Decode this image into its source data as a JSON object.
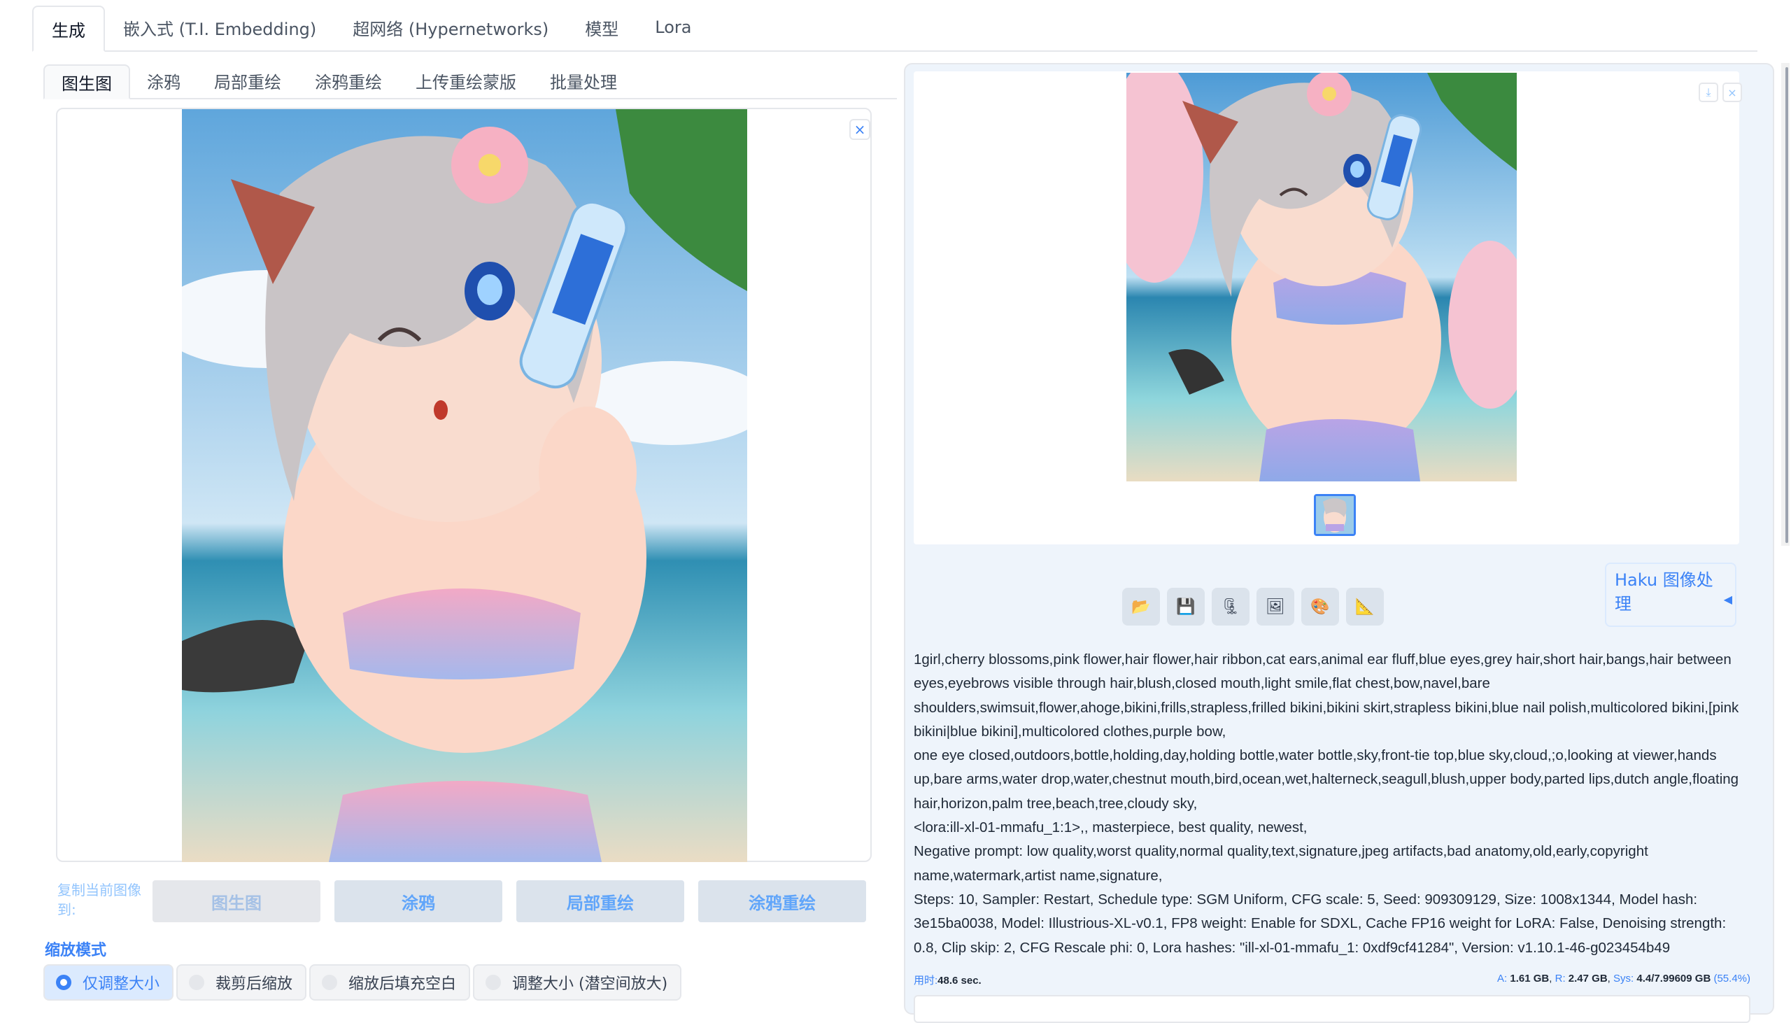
{
  "top_tabs": [
    "生成",
    "嵌入式 (T.I. Embedding)",
    "超网络 (Hypernetworks)",
    "模型",
    "Lora"
  ],
  "sub_tabs": [
    "图生图",
    "涂鸦",
    "局部重绘",
    "涂鸦重绘",
    "上传重绘蒙版",
    "批量处理"
  ],
  "copy": {
    "label": "复制当前图像到:",
    "buttons": [
      "图生图",
      "涂鸦",
      "局部重绘",
      "涂鸦重绘"
    ]
  },
  "scale": {
    "label": "缩放模式",
    "options": [
      "仅调整大小",
      "裁剪后缩放",
      "缩放后填充空白",
      "调整大小 (潜空间放大)"
    ],
    "selected": "仅调整大小"
  },
  "icons": {
    "close": "×",
    "download": "⤓",
    "folder": "📂",
    "save": "💾",
    "zip": "🗜",
    "image": "🖼",
    "palette": "🎨",
    "ruler": "📐"
  },
  "haku": {
    "label": "Haku 图像处理",
    "arrow": "◀"
  },
  "gen_info": [
    "1girl,cherry blossoms,pink flower,hair flower,hair ribbon,cat ears,animal ear fluff,blue eyes,grey hair,short hair,bangs,hair between eyes,eyebrows visible through hair,blush,closed mouth,light smile,flat chest,bow,navel,bare shoulders,swimsuit,flower,ahoge,bikini,frills,strapless,frilled bikini,bikini skirt,strapless bikini,blue nail polish,multicolored bikini,[pink bikini|blue bikini],multicolored clothes,purple bow,",
    "one eye closed,outdoors,bottle,holding,day,holding bottle,water bottle,sky,front-tie top,blue sky,cloud,;o,looking at viewer,hands up,bare arms,water drop,water,chestnut mouth,bird,ocean,wet,halterneck,seagull,blush,upper body,parted lips,dutch angle,floating hair,horizon,palm tree,beach,tree,cloudy sky,",
    "<lora:ill-xl-01-mmafu_1:1>,, masterpiece, best quality, newest,",
    "Negative prompt: low quality,worst quality,normal quality,text,signature,jpeg artifacts,bad anatomy,old,early,copyright name,watermark,artist name,signature,",
    "Steps: 10, Sampler: Restart, Schedule type: SGM Uniform, CFG scale: 5, Seed: 909309129, Size: 1008x1344, Model hash: 3e15ba0038, Model: Illustrious-XL-v0.1, FP8 weight: Enable for SDXL, Cache FP16 weight for LoRA: False, Denoising strength: 0.8, Clip skip: 2, CFG Rescale phi: 0, Lora hashes: \"ill-xl-01-mmafu_1: 0xdf9cf41284\", Version: v1.10.1-46-g023454b49"
  ],
  "stats": {
    "time_label": "用时:",
    "time_value": "48.6 sec.",
    "a_label": "A:",
    "a_value": "1.61 GB",
    "r_label": "R:",
    "r_value": "2.47 GB",
    "sys_label": "Sys:",
    "sys_value": "4.4/7.99609 GB",
    "sys_pct": "(55.4%)"
  }
}
